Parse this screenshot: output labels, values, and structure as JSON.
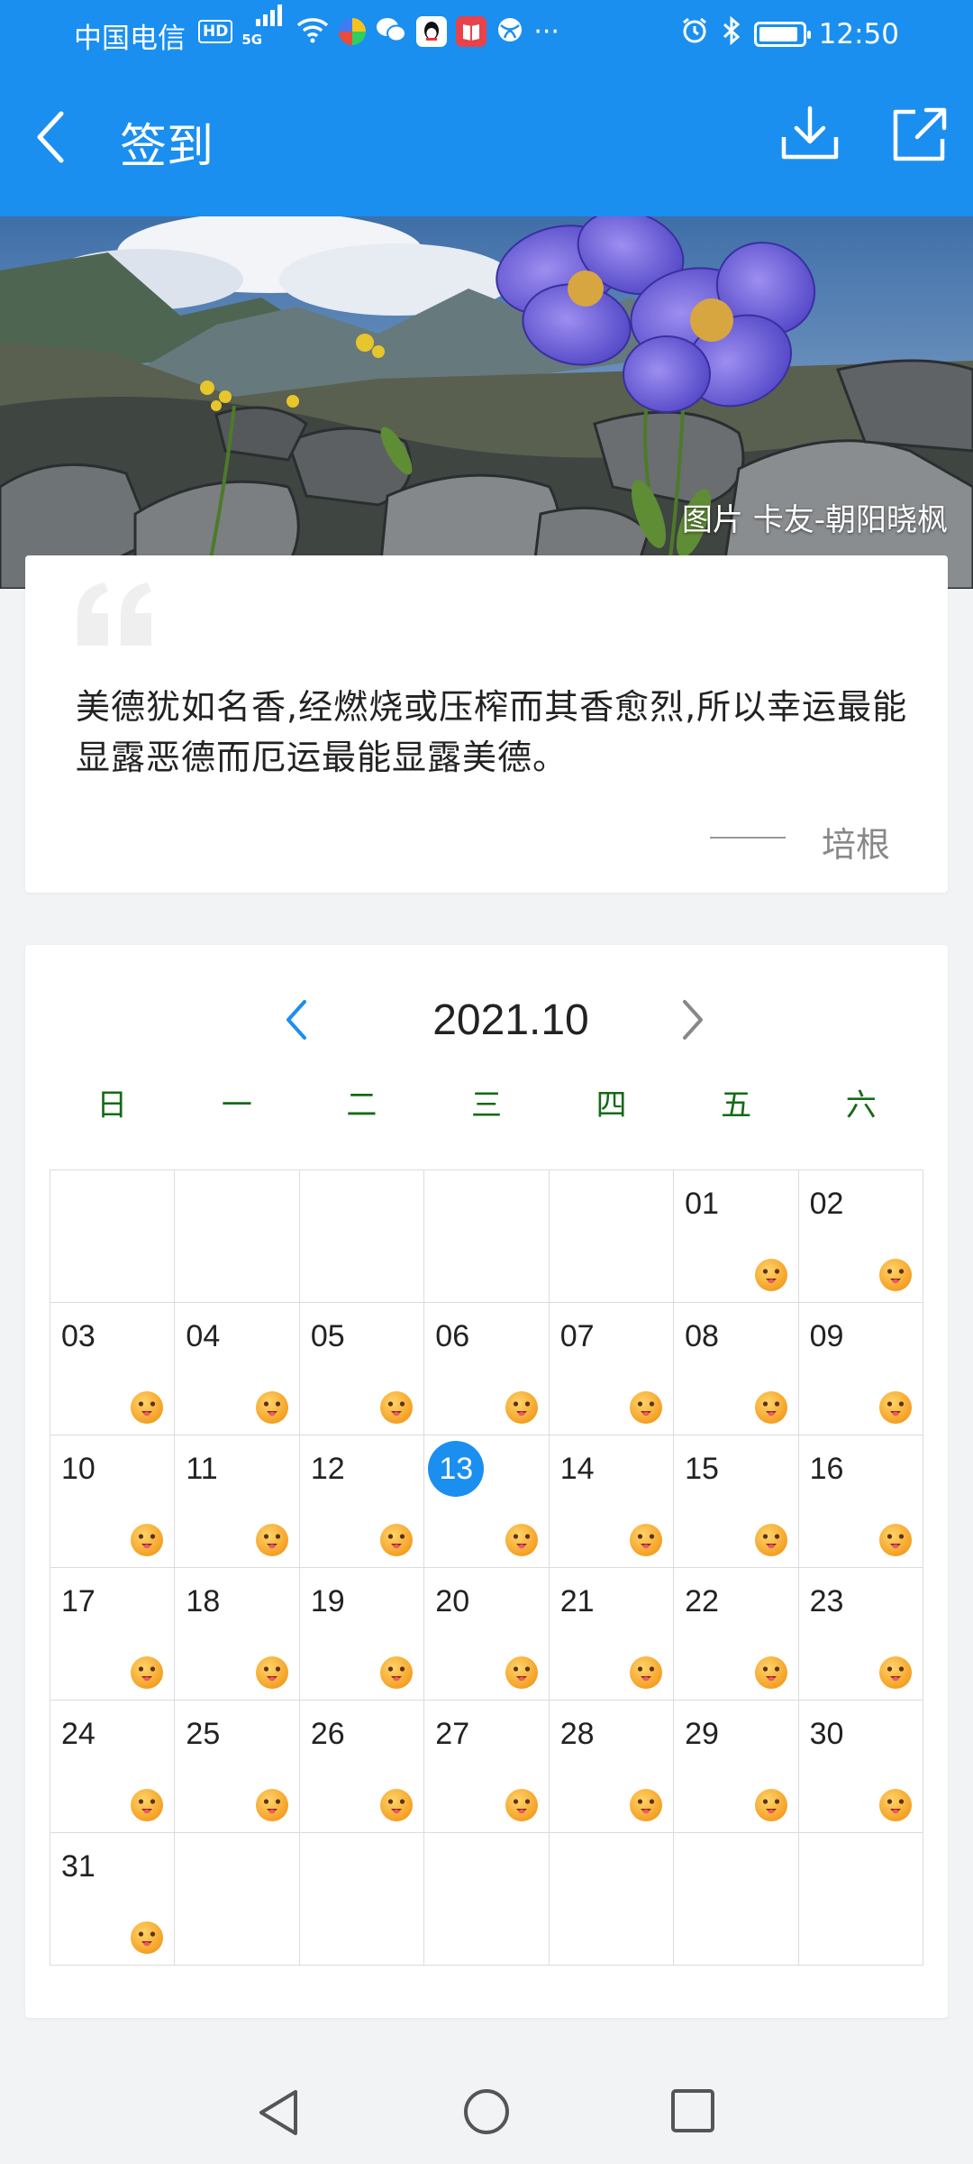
{
  "status_bar": {
    "carrier": "中国电信",
    "hd_badge": "HD",
    "network": "5G",
    "time": "12:50",
    "more": "···"
  },
  "app_bar": {
    "title": "签到",
    "icons": [
      "back-arrow-icon",
      "download-icon",
      "share-icon"
    ]
  },
  "banner": {
    "credit": "图片 卡友-朝阳晓枫"
  },
  "quote": {
    "text": "美德犹如名香,经燃烧或压榨而其香愈烈,所以幸运最能显露恶德而厄运最能显露美德。",
    "author": "培根"
  },
  "calendar": {
    "month_label": "2021.10",
    "weekdays": [
      "日",
      "一",
      "二",
      "三",
      "四",
      "五",
      "六"
    ],
    "leading_blanks": 5,
    "days": [
      "01",
      "02",
      "03",
      "04",
      "05",
      "06",
      "07",
      "08",
      "09",
      "10",
      "11",
      "12",
      "13",
      "14",
      "15",
      "16",
      "17",
      "18",
      "19",
      "20",
      "21",
      "22",
      "23",
      "24",
      "25",
      "26",
      "27",
      "28",
      "29",
      "30",
      "31"
    ],
    "today": "13",
    "checked_in_icon": "smiley-face-icon",
    "accent_color": "#1a8ff0",
    "weekday_color": "#166a16"
  },
  "nav_bar": {
    "icons": [
      "back-triangle-icon",
      "home-circle-icon",
      "recents-square-icon"
    ]
  }
}
